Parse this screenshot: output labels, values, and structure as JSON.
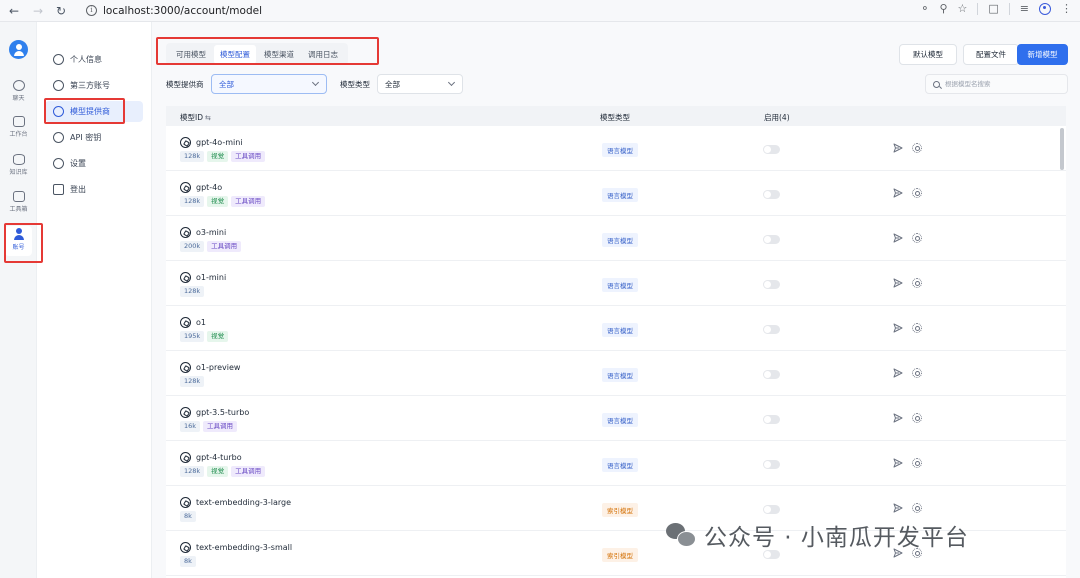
{
  "browser": {
    "url": "localhost:3000/account/model"
  },
  "rail": {
    "items": [
      {
        "label": "聊天",
        "icon": "chat-icon"
      },
      {
        "label": "工作台",
        "icon": "robot-icon"
      },
      {
        "label": "知识库",
        "icon": "database-icon"
      },
      {
        "label": "工具箱",
        "icon": "toolbox-icon"
      },
      {
        "label": "账号",
        "icon": "user-icon",
        "active": true
      }
    ]
  },
  "sidebar": {
    "items": [
      {
        "label": "个人信息",
        "icon": "user-icon"
      },
      {
        "label": "第三方账号",
        "icon": "link-icon"
      },
      {
        "label": "模型提供商",
        "icon": "model-provider-icon",
        "active": true
      },
      {
        "label": "API 密钥",
        "icon": "key-icon"
      },
      {
        "label": "设置",
        "icon": "gear-icon"
      },
      {
        "label": "登出",
        "icon": "logout-icon"
      }
    ]
  },
  "tabs": [
    {
      "label": "可用模型"
    },
    {
      "label": "模型配置",
      "active": true
    },
    {
      "label": "模型渠道"
    },
    {
      "label": "调用日志"
    }
  ],
  "actions": {
    "default_model": "默认模型",
    "config_file": "配置文件",
    "new_model": "新增模型"
  },
  "filters": {
    "provider_label": "模型提供商",
    "provider_value": "全部",
    "type_label": "模型类型",
    "type_value": "全部",
    "search_placeholder": "根据模型名搜索"
  },
  "table": {
    "headers": {
      "model_id": "模型ID",
      "model_type": "模型类型",
      "enabled": "启用(4)"
    },
    "rows": [
      {
        "name": "gpt-4o-mini",
        "tags": [
          {
            "text": "128k",
            "kind": "gray"
          },
          {
            "text": "视觉",
            "kind": "green"
          },
          {
            "text": "工具调用",
            "kind": "purple"
          }
        ],
        "type": "语言模型",
        "type_kind": "blue",
        "enabled": false
      },
      {
        "name": "gpt-4o",
        "tags": [
          {
            "text": "128k",
            "kind": "gray"
          },
          {
            "text": "视觉",
            "kind": "green"
          },
          {
            "text": "工具调用",
            "kind": "purple"
          }
        ],
        "type": "语言模型",
        "type_kind": "blue",
        "enabled": false
      },
      {
        "name": "o3-mini",
        "tags": [
          {
            "text": "200k",
            "kind": "gray"
          },
          {
            "text": "工具调用",
            "kind": "purple"
          }
        ],
        "type": "语言模型",
        "type_kind": "blue",
        "enabled": false
      },
      {
        "name": "o1-mini",
        "tags": [
          {
            "text": "128k",
            "kind": "gray"
          }
        ],
        "type": "语言模型",
        "type_kind": "blue",
        "enabled": false
      },
      {
        "name": "o1",
        "tags": [
          {
            "text": "195k",
            "kind": "gray"
          },
          {
            "text": "视觉",
            "kind": "green"
          }
        ],
        "type": "语言模型",
        "type_kind": "blue",
        "enabled": false
      },
      {
        "name": "o1-preview",
        "tags": [
          {
            "text": "128k",
            "kind": "gray"
          }
        ],
        "type": "语言模型",
        "type_kind": "blue",
        "enabled": false
      },
      {
        "name": "gpt-3.5-turbo",
        "tags": [
          {
            "text": "16k",
            "kind": "gray"
          },
          {
            "text": "工具调用",
            "kind": "purple"
          }
        ],
        "type": "语言模型",
        "type_kind": "blue",
        "enabled": false
      },
      {
        "name": "gpt-4-turbo",
        "tags": [
          {
            "text": "128k",
            "kind": "gray"
          },
          {
            "text": "视觉",
            "kind": "green"
          },
          {
            "text": "工具调用",
            "kind": "purple"
          }
        ],
        "type": "语言模型",
        "type_kind": "blue",
        "enabled": false
      },
      {
        "name": "text-embedding-3-large",
        "tags": [
          {
            "text": "8k",
            "kind": "gray"
          }
        ],
        "type": "索引模型",
        "type_kind": "orange",
        "enabled": false
      },
      {
        "name": "text-embedding-3-small",
        "tags": [
          {
            "text": "8k",
            "kind": "gray"
          }
        ],
        "type": "索引模型",
        "type_kind": "orange",
        "enabled": false
      }
    ]
  },
  "watermark": {
    "text": "公众号 · 小南瓜开发平台"
  },
  "colors": {
    "accent": "#2f6fed",
    "annotation_red": "#e53935"
  }
}
